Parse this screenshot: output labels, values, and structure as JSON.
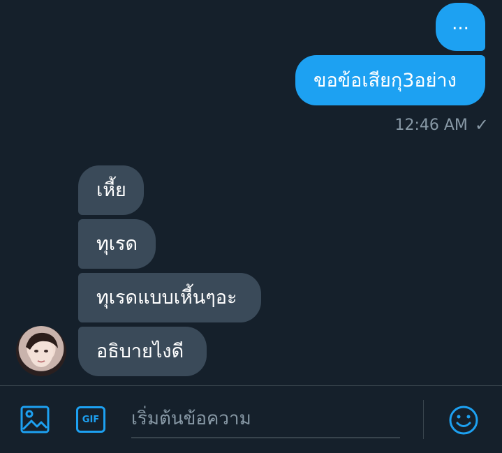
{
  "messages": {
    "outgoing": [
      {
        "text": "..."
      },
      {
        "text": "ขอข้อเสียกุ3อย่าง"
      }
    ],
    "timestamp": "12:46 AM",
    "status_icon": "check-icon",
    "incoming": [
      {
        "text": "เหี้ย"
      },
      {
        "text": "ทุเรด"
      },
      {
        "text": "ทุเรดแบบเหี้นๆอะ"
      },
      {
        "text": "อธิบายไงดี"
      }
    ]
  },
  "composer": {
    "placeholder": "เริ่มต้นข้อความ",
    "value": "",
    "gif_label": "GIF",
    "icons": [
      "image-icon",
      "gif-icon",
      "emoji-icon"
    ]
  },
  "colors": {
    "background": "#15202b",
    "outgoing_bubble": "#1da1f2",
    "incoming_bubble": "#3a4a59",
    "accent": "#1da1f2",
    "muted_text": "#8899a6",
    "border": "#38444d"
  }
}
